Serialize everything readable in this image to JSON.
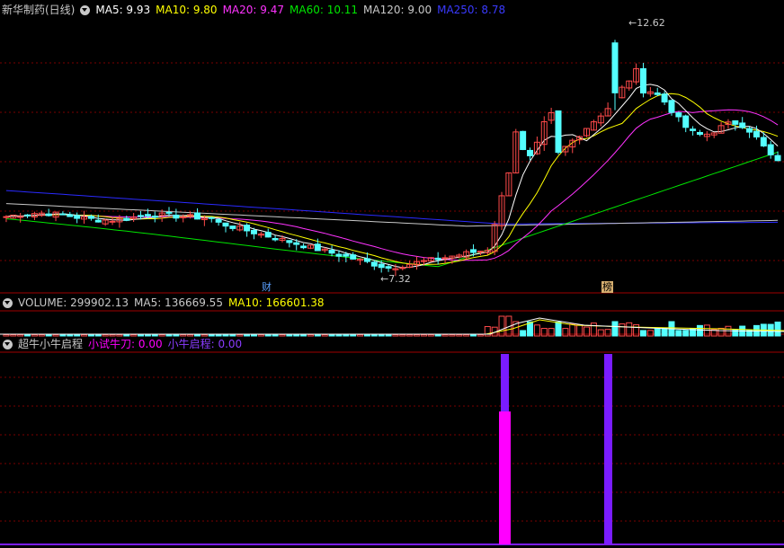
{
  "colors": {
    "up": "#ff4a4a",
    "down": "#54ffff",
    "ma5": "#ffffff",
    "ma10": "#ffff00",
    "ma20": "#ff33ff",
    "ma60": "#00e600",
    "ma120": "#c8c8c8",
    "ma250": "#2a2aff",
    "grid": "#7a0000",
    "indicator1": "#ff00ff",
    "indicator2": "#7a1cff"
  },
  "price_header": {
    "title": "新华制药(日线)",
    "ma5": "MA5: 9.93",
    "ma10": "MA10: 9.80",
    "ma20": "MA20: 9.47",
    "ma60": "MA60: 10.11",
    "ma120": "MA120: 9.00",
    "ma250": "MA250: 8.78"
  },
  "volume_header": {
    "volume": "VOLUME: 299902.13",
    "ma5": "MA5: 136669.55",
    "ma10": "MA10: 166601.38"
  },
  "indicator_header": {
    "name": "超牛小牛启程",
    "line1": "小试牛刀: 0.00",
    "line2": "小牛启程: 0.00"
  },
  "annotations": {
    "high": "12.62",
    "low": "7.32",
    "tag_cai": "财",
    "tag_bang": "榜"
  },
  "chart_data": {
    "type": "candlestick",
    "price_range": [
      7.0,
      13.0
    ],
    "high_value": 12.62,
    "low_value": 7.32,
    "ma_last": {
      "ma5": 9.93,
      "ma10": 9.8,
      "ma20": 9.47,
      "ma60": 10.11,
      "ma120": 9.0,
      "ma250": 8.78
    },
    "volume_last": 299902.13,
    "volume_ma5": 136669.55,
    "volume_ma10": 166601.38,
    "indicator_values": {
      "xiaoshiniudao": 0.0,
      "xiaoniuqicheng": 0.0
    }
  }
}
